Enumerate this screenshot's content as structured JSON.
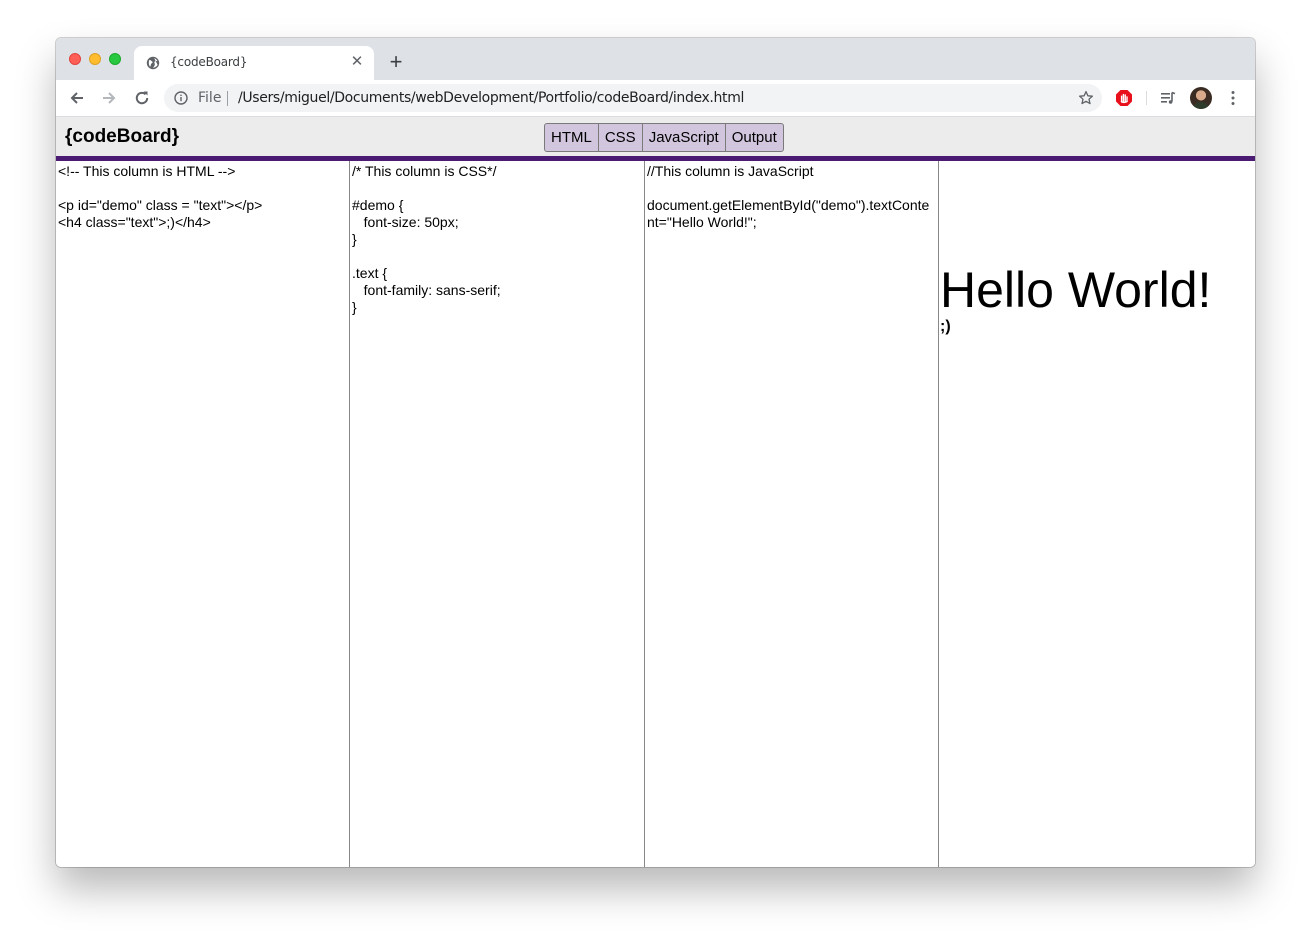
{
  "browser": {
    "tab_title": "{codeBoard}",
    "new_tab_label": "+",
    "close_label": "✕",
    "address_scheme": "File",
    "address_url": "/Users/miguel/Documents/webDevelopment/Portfolio/codeBoard/index.html"
  },
  "app": {
    "logo": "{codeBoard}",
    "toggles": [
      {
        "label": "HTML"
      },
      {
        "label": "CSS"
      },
      {
        "label": "JavaScript"
      },
      {
        "label": "Output"
      }
    ],
    "accent_color": "#4b1a73",
    "toggle_bg_color": "#d2c6de"
  },
  "panels": {
    "html": "<!-- This column is HTML -->\n\n<p id=\"demo\" class = \"text\"></p>\n<h4 class=\"text\">;)</h4>",
    "css": "/* This column is CSS*/\n\n#demo {\n   font-size: 50px;\n}\n\n.text {\n   font-family: sans-serif;\n}",
    "js": "//This column is JavaScript\n\ndocument.getElementById(\"demo\").textContent=\"Hello World!\";",
    "output": {
      "demo_text": "Hello World!",
      "h4_text": ";)"
    }
  }
}
